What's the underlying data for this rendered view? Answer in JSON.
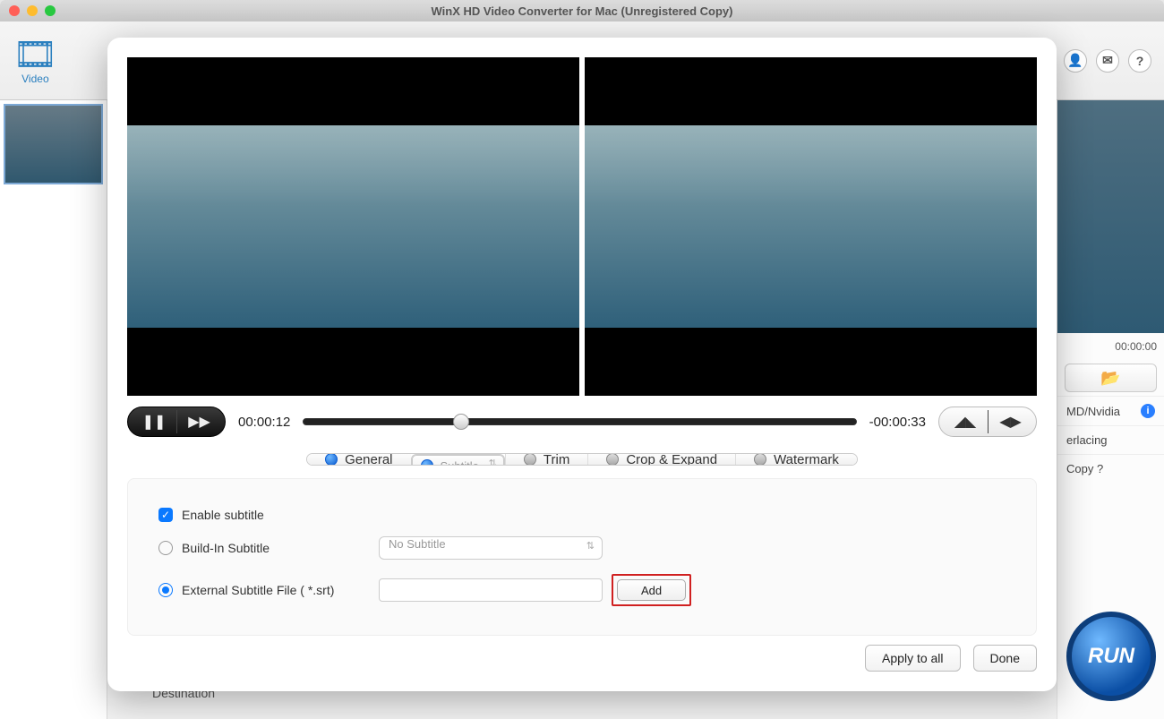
{
  "title": "WinX HD Video Converter for Mac (Unregistered Copy)",
  "toolbar": {
    "video_label": "Video"
  },
  "header_icons": {
    "user": "user-icon",
    "mail": "mail-icon",
    "help": "help-icon"
  },
  "right": {
    "time": "00:00:00",
    "opt_gpu": "MD/Nvidia",
    "opt_deint": "erlacing",
    "opt_copy": "Copy ?",
    "run": "RUN"
  },
  "destination_label": "Destination",
  "playback": {
    "elapsed": "00:00:12",
    "remaining": "-00:00:33"
  },
  "tabs": [
    {
      "label": "General",
      "active": true,
      "selected": false
    },
    {
      "label": "Subtitle",
      "active": false,
      "selected": true
    },
    {
      "label": "Trim",
      "active": false,
      "selected": false
    },
    {
      "label": "Crop & Expand",
      "active": false,
      "selected": false
    },
    {
      "label": "Watermark",
      "active": false,
      "selected": false
    }
  ],
  "form": {
    "enable": "Enable subtitle",
    "builtin": "Build-In Subtitle",
    "builtin_select": "No Subtitle",
    "external": "External Subtitle File ( *.srt)",
    "add": "Add"
  },
  "footer": {
    "apply": "Apply to all",
    "done": "Done"
  }
}
